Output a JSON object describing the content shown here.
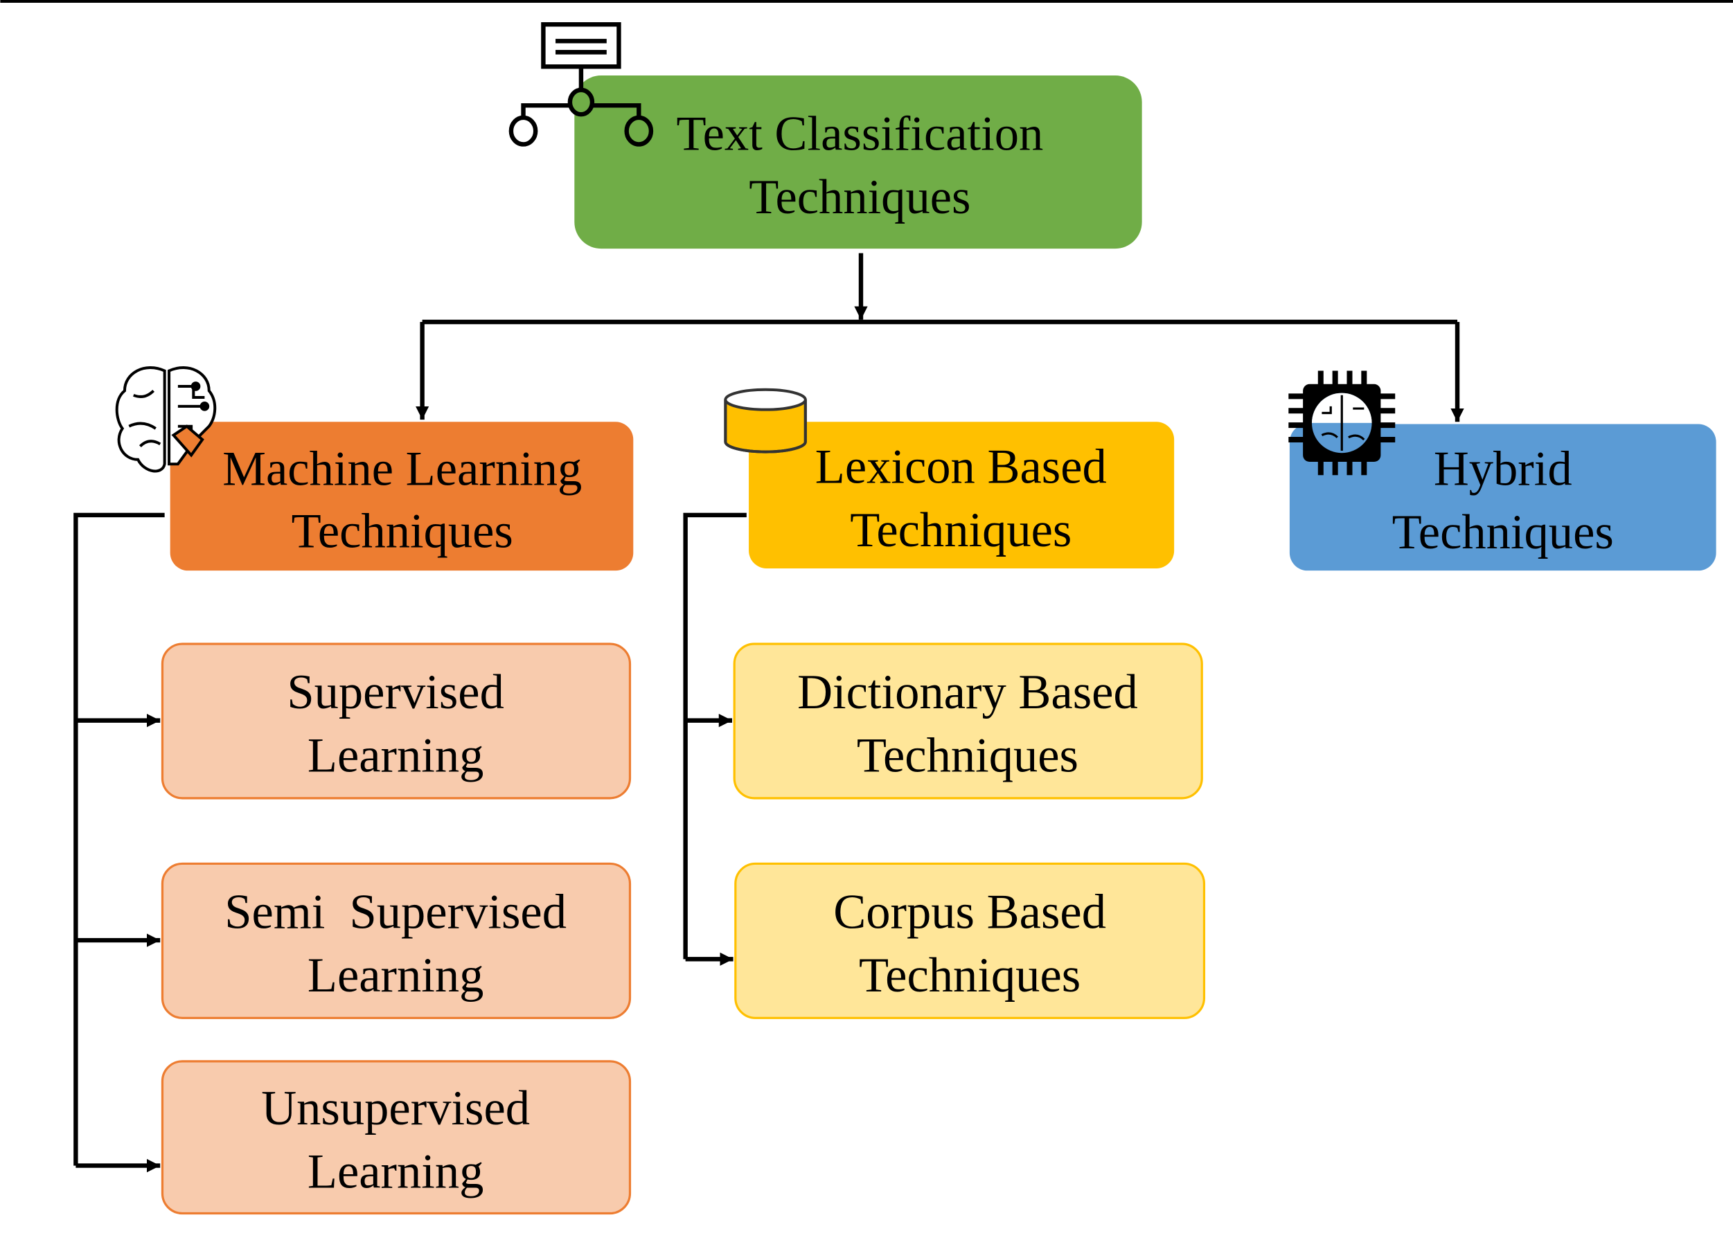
{
  "root": {
    "lines": [
      "Text Classification",
      "Techniques"
    ],
    "color": "#70AD47",
    "icon": "hierarchy-document-icon"
  },
  "categories": [
    {
      "id": "machine-learning",
      "lines": [
        "Machine Learning",
        "Techniques"
      ],
      "color": "#ED7D31",
      "icon": "brain-circuit-icon",
      "children": [
        {
          "lines": [
            "Supervised",
            "Learning"
          ]
        },
        {
          "lines": [
            "Semi  Supervised",
            "Learning"
          ]
        },
        {
          "lines": [
            "Unsupervised",
            "Learning"
          ]
        }
      ],
      "child_fill": "#F8CBAD"
    },
    {
      "id": "lexicon",
      "lines": [
        "Lexicon Based",
        "Techniques"
      ],
      "color": "#FFC000",
      "icon": "database-icon",
      "children": [
        {
          "lines": [
            "Dictionary Based",
            "Techniques"
          ]
        },
        {
          "lines": [
            "Corpus Based",
            "Techniques"
          ]
        }
      ],
      "child_fill": "#FFE699"
    },
    {
      "id": "hybrid",
      "lines": [
        "Hybrid",
        "Techniques"
      ],
      "color": "#5B9BD5",
      "icon": "ai-chip-brain-icon",
      "children": []
    }
  ]
}
